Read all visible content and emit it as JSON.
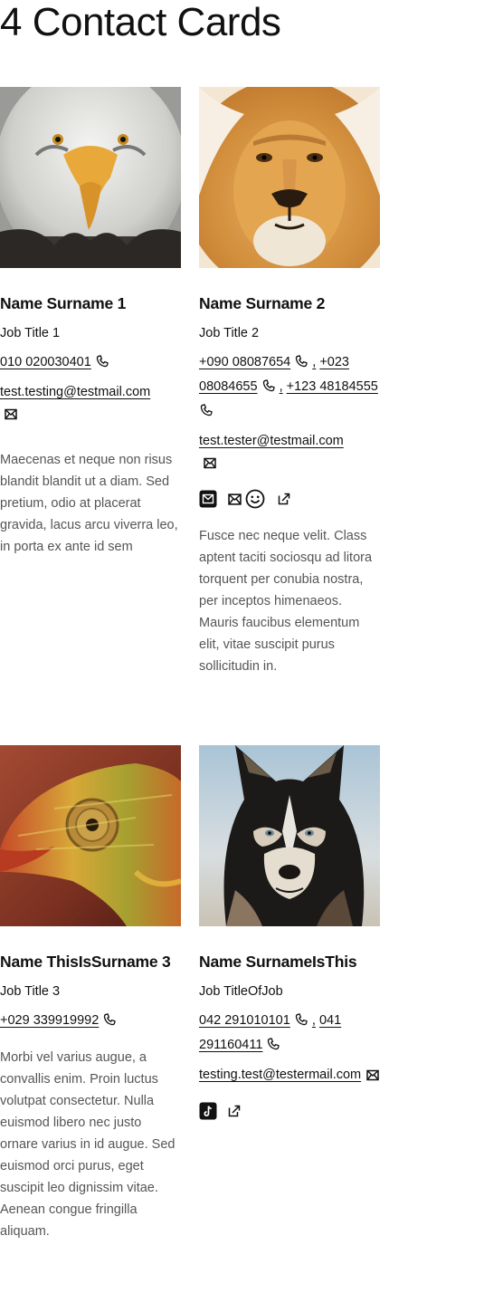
{
  "page": {
    "title": "4 Contact Cards"
  },
  "cards": [
    {
      "name": "Name Surname 1",
      "job": "Job Title 1",
      "phones": [
        "010 020030401"
      ],
      "email": "test.testing@testmail.com",
      "bio": "Maecenas et neque non risus blandit blandit ut a diam. Sed pretium, odio at placerat gravida, lacus arcu viverra leo, in porta ex ante id sem",
      "photo": "eagle-photo"
    },
    {
      "name": "Name Surname 2",
      "job": "Job Title 2",
      "phones": [
        "+090 08087654",
        "+023 08084655",
        "+123 48184555"
      ],
      "email": "test.tester@testmail.com",
      "social": [
        "mail-square-icon",
        "mail-icon",
        "smiley-icon",
        "external-link-icon"
      ],
      "bio": "Fusce nec neque velit. Class aptent taciti sociosqu ad litora torquent per conubia nostra, per inceptos himenaeos. Mauris faucibus elementum elit, vitae suscipit purus sollicitudin in.",
      "photo": "lion-photo"
    },
    {
      "name": "Name ThisIsSurname 3",
      "job": "Job Title 3",
      "phones": [
        "+029 339919992"
      ],
      "bio": "Morbi vel varius augue, a convallis enim. Proin luctus volutpat consectetur. Nulla euismod libero nec justo ornare varius in id augue. Sed euismod orci purus, eget suscipit leo dignissim vitae. Aenean congue fringilla aliquam.",
      "photo": "chameleon-photo"
    },
    {
      "name": "Name SurnameIsThis",
      "job": "Job TitleOfJob",
      "phones": [
        "042 291010101",
        "041 291160411"
      ],
      "email": "testing.test@testermail.com",
      "social": [
        "tiktok-icon",
        "external-link-icon"
      ],
      "photo": "husky-photo"
    }
  ],
  "separator": ","
}
